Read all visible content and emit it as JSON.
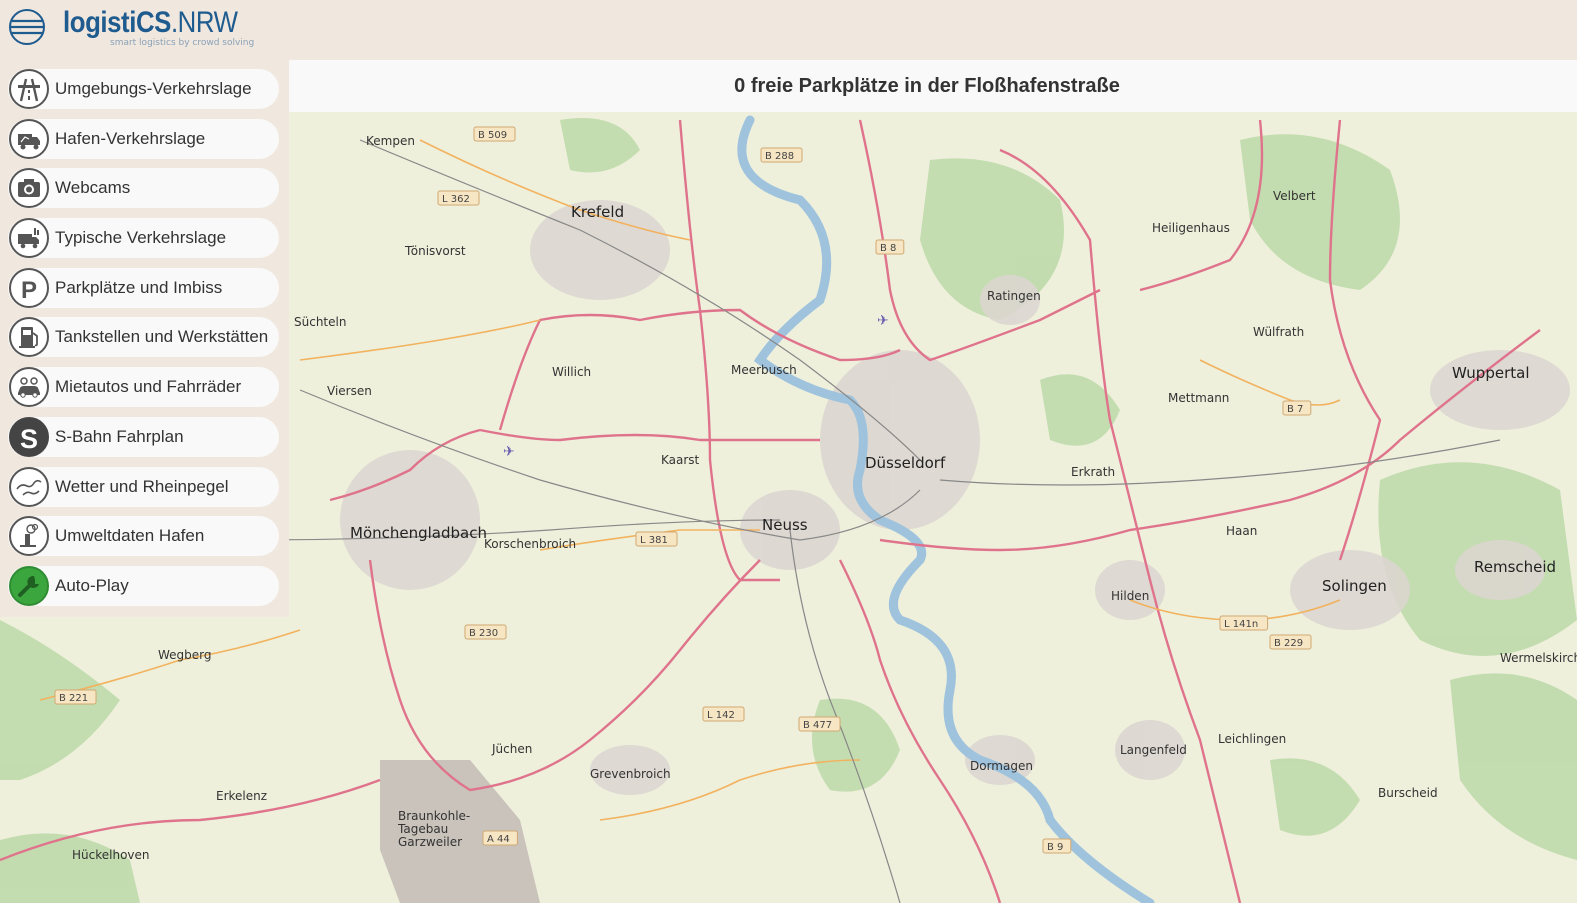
{
  "app": {
    "logo_bold": "logistiCS",
    "logo_light": ".NRW",
    "tagline": "smart logistics by crowd solving"
  },
  "title": "0 freie Parkplätze in der Floßhafenstraße",
  "menu": {
    "items": [
      {
        "label": "Umgebungs-Verkehrslage",
        "icon": "highway-icon"
      },
      {
        "label": "Hafen-Verkehrslage",
        "icon": "truck-icon"
      },
      {
        "label": "Webcams",
        "icon": "camera-icon"
      },
      {
        "label": "Typische Verkehrslage",
        "icon": "truck-chart-icon"
      },
      {
        "label": "Parkplätze und Imbiss",
        "icon": "parking-icon"
      },
      {
        "label": "Tankstellen und Werkstätten",
        "icon": "fuel-icon"
      },
      {
        "label": "Mietautos und Fahrräder",
        "icon": "car-bike-icon"
      },
      {
        "label": "S-Bahn Fahrplan",
        "icon": "sbahn-icon"
      },
      {
        "label": "Wetter und Rheinpegel",
        "icon": "weather-icon"
      },
      {
        "label": "Umweltdaten Hafen",
        "icon": "environment-icon"
      },
      {
        "label": "Auto-Play",
        "icon": "autoplay-icon"
      }
    ]
  },
  "map": {
    "places": [
      "Kempen",
      "Krefeld",
      "Tönisvorst",
      "Süchteln",
      "Viersen",
      "Willich",
      "Meerbusch",
      "Ratingen",
      "Heiligenhaus",
      "Velbert",
      "Wülfrath",
      "Wuppertal",
      "Mettmann",
      "Düsseldorf",
      "Erkrath",
      "Kaarst",
      "Neuss",
      "Mönchengladbach",
      "Korschenbroich",
      "Haan",
      "Hilden",
      "Solingen",
      "Remscheid",
      "Wegberg",
      "Jüchen",
      "Grevenbroich",
      "Dormagen",
      "Langenfeld",
      "Leichlingen",
      "Erkelenz",
      "Hückelhoven",
      "Burscheid",
      "Wermelskirch",
      "Braunkohle-\nTagebau\nGarzweiler"
    ],
    "roads": [
      "B 509",
      "L 362",
      "B 288",
      "B 8",
      "B 7",
      "L 381",
      "B 230",
      "B 221",
      "L 142",
      "B 477",
      "A 44",
      "B 9",
      "L 141n",
      "B 229"
    ]
  }
}
